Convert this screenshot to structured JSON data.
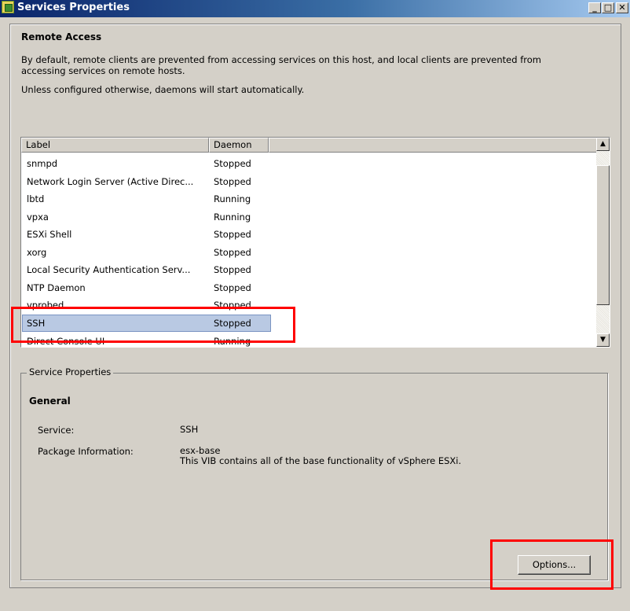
{
  "window": {
    "title": "Services Properties"
  },
  "header": {
    "title": "Remote Access",
    "description_1": "By default, remote clients are prevented from accessing services on this host, and local clients are prevented from",
    "description_2": "accessing services on remote hosts.",
    "description_3": "Unless configured otherwise, daemons will start automatically."
  },
  "service_list": {
    "columns": [
      "Label",
      "Daemon"
    ],
    "rows": [
      {
        "label": "snmpd",
        "daemon": "Stopped"
      },
      {
        "label": "Network Login Server (Active Direc...",
        "daemon": "Stopped"
      },
      {
        "label": "lbtd",
        "daemon": "Running"
      },
      {
        "label": "vpxa",
        "daemon": "Running"
      },
      {
        "label": "ESXi Shell",
        "daemon": "Stopped"
      },
      {
        "label": "xorg",
        "daemon": "Stopped"
      },
      {
        "label": "Local Security Authentication Serv...",
        "daemon": "Stopped"
      },
      {
        "label": "NTP Daemon",
        "daemon": "Stopped"
      },
      {
        "label": "vprobed",
        "daemon": "Stopped"
      },
      {
        "label": "SSH",
        "daemon": "Stopped",
        "selected": true
      },
      {
        "label": "Direct Console UI",
        "daemon": "Running"
      }
    ]
  },
  "service_properties": {
    "group_label": "Service Properties",
    "section_title": "General",
    "service_label": "Service:",
    "service_value": "SSH",
    "package_label": "Package Information:",
    "package_name": "esx-base",
    "package_desc": "This VIB contains all of the base functionality of vSphere ESXi.",
    "options_button": "Options..."
  },
  "colors": {
    "selection": "#b9c9e3",
    "highlight_box": "#ff0000",
    "titlebar": "#0a246a"
  }
}
